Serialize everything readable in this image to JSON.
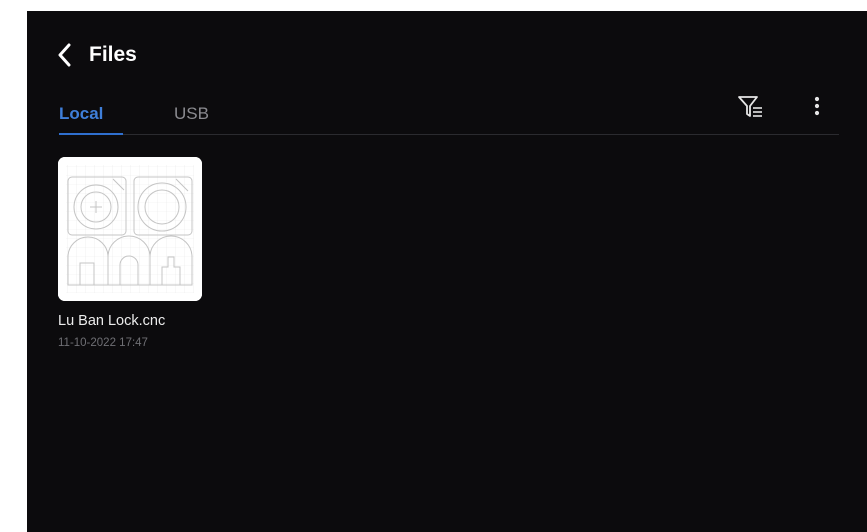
{
  "header": {
    "title": "Files",
    "back_icon": "chevron-left-icon"
  },
  "tabs": [
    {
      "label": "Local",
      "active": true
    },
    {
      "label": "USB",
      "active": false
    }
  ],
  "toolbar": {
    "filter_icon": "filter-list-icon",
    "more_icon": "more-vertical-icon"
  },
  "files": [
    {
      "name": "Lu Ban Lock.cnc",
      "date": "11-10-2022  17:47"
    }
  ],
  "colors": {
    "background": "#0c0b0d",
    "accent": "#3f7fd9",
    "inactive_tab": "#8b8b90",
    "date_text": "#6f6f74"
  }
}
